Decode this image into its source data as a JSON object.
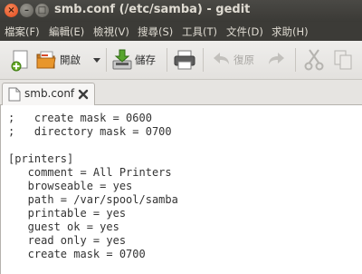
{
  "window": {
    "title": "smb.conf (/etc/samba) - gedit",
    "close_glyph": "×",
    "minimize_glyph": "–",
    "maximize_glyph": "□"
  },
  "menu": [
    "檔案(F)",
    "編輯(E)",
    "檢視(V)",
    "搜尋(S)",
    "工具(T)",
    "文件(D)",
    "求助(H)"
  ],
  "toolbar": {
    "new_icon": "new-document-icon",
    "open_label": "開啟",
    "open_icon": "folder-open-icon",
    "dropdown_icon": "chevron-down-icon",
    "save_label": "儲存",
    "save_icon": "save-icon",
    "print_icon": "printer-icon",
    "undo_label": "復原",
    "undo_icon": "undo-icon",
    "redo_icon": "redo-icon",
    "cut_icon": "scissors-icon",
    "copy_icon": "copy-icon"
  },
  "tab": {
    "label": "smb.conf",
    "icon": "document-icon",
    "close_icon": "close-icon"
  },
  "editor": {
    "lines": [
      ";   create mask = 0600",
      ";   directory mask = 0700",
      "",
      "[printers]",
      "   comment = All Printers",
      "   browseable = yes",
      "   path = /var/spool/samba",
      "   printable = yes",
      "   guest ok = yes",
      "   read only = yes",
      "   create mask = 0700"
    ]
  }
}
